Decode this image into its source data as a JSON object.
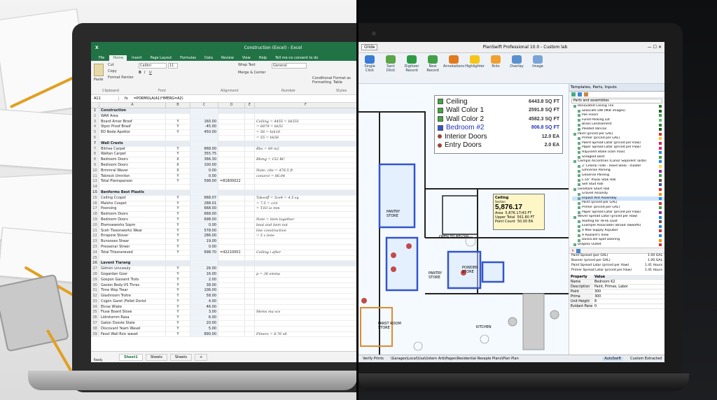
{
  "excel": {
    "title": "Construction (Excel) - Excel",
    "search": "Tell me no consent to do",
    "tabs": [
      "File",
      "Home",
      "Insert",
      "Page Layout",
      "Formulas",
      "Data",
      "Review",
      "View",
      "Help",
      "Help"
    ],
    "ribbon": {
      "paste": "Paste",
      "cut": "Cut",
      "copy": "Copy",
      "format_painter": "Format Painter",
      "clipboard": "Clipboard",
      "font_name": "Calibri",
      "font_size": "11",
      "font": "Font",
      "wrap": "Wrap Text",
      "merge": "Merge & Center",
      "alignment": "Alignment",
      "number_format": "General",
      "number": "Number",
      "cond": "Conditional Formatting",
      "format_as": "Format as Table",
      "styles": "Styles"
    },
    "name_box": "A11",
    "formula": "=PORMULA(A1)*IMERG=A2)",
    "columns": [
      "A",
      "B",
      "C",
      "D",
      "E",
      "F"
    ],
    "rows": [
      {
        "n": "1",
        "a": "Construction",
        "b": "",
        "c": "",
        "d": "",
        "f": "",
        "sec": true
      },
      {
        "n": "2",
        "a": "WAR Area",
        "b": "",
        "c": "",
        "d": "",
        "f": ""
      },
      {
        "n": "3",
        "a": "Board Arner Broof",
        "b": "Y",
        "c": "160.00",
        "d": "",
        "f": "Ceiling = 4455 = bk551"
      },
      {
        "n": "4",
        "a": "Stpor Proof Braof",
        "b": "Y",
        "c": "-45.00",
        "d": "",
        "f": "= 6879 = bk51"
      },
      {
        "n": "5",
        "a": "ED Node Apottor",
        "b": "Y",
        "c": "450.00",
        "d": "",
        "f": "= 56 = b(k16"
      },
      {
        "n": "6",
        "a": "",
        "b": "",
        "c": "",
        "d": "",
        "f": "= 55 = bk56"
      },
      {
        "n": "7",
        "a": "Wall Crests",
        "b": "",
        "c": "",
        "d": "",
        "f": "",
        "sec": true
      },
      {
        "n": "7",
        "a": "Bikhse Carpet",
        "b": "Y",
        "c": "668.00",
        "d": "",
        "f": "Rbs = 89 m2"
      },
      {
        "n": "8",
        "a": "Waltan Carpet",
        "b": "Y",
        "c": "355.75",
        "d": "",
        "f": ""
      },
      {
        "n": "8",
        "a": "Bedroom Doors",
        "b": "X",
        "c": "366.30",
        "d": "",
        "f": "Rbmg = 152 BC"
      },
      {
        "n": "9",
        "a": "Bedroom Doors",
        "b": "X",
        "c": "100.00",
        "d": "",
        "f": ""
      },
      {
        "n": "10",
        "a": "Brmmral Waver",
        "b": "X",
        "c": "0.00",
        "d": "",
        "f": "Note: cite = 476.5 ft"
      },
      {
        "n": "11",
        "a": "Tobrock Umnlion",
        "b": "Y",
        "c": "0.00",
        "d": "",
        "f": "conorct = 86.04"
      },
      {
        "n": "13",
        "a": "Total Plamsparson",
        "b": "Y",
        "c": "598.00",
        "d": "=81800022",
        "f": ""
      },
      {
        "n": "14",
        "a": "",
        "b": "",
        "c": "",
        "d": "",
        "f": ""
      },
      {
        "n": "15",
        "a": "Benforms Best Plastls",
        "b": "",
        "c": "",
        "d": "",
        "f": "",
        "sec": true
      },
      {
        "n": "15",
        "a": "Ceiling Ccopst",
        "b": "Y",
        "c": "668.07",
        "d": "",
        "f": "Takeoff = 5ce4 = 4.5 sq"
      },
      {
        "n": "16",
        "a": "Malsho Cospet",
        "b": "Y",
        "c": "288.01",
        "d": "",
        "f": "= 7.5 = c/ct"
      },
      {
        "n": "17",
        "a": "Poonsing",
        "b": "Y",
        "c": "668.00",
        "d": "",
        "f": "= T.03 ie mm"
      },
      {
        "n": "18",
        "a": "Bedroom Doors",
        "b": "Y",
        "c": "668.00",
        "d": "",
        "f": ""
      },
      {
        "n": "19",
        "a": "Bedroom Doors",
        "b": "Y",
        "c": "698.00",
        "d": "",
        "f": "Note = item together"
      },
      {
        "n": "20",
        "a": "Etemseworks Sopm",
        "b": "Y",
        "c": "0.00",
        "d": "",
        "f": "beat and item not"
      },
      {
        "n": "21",
        "a": "Sceh Tiseonworks Wear",
        "b": "Y",
        "c": "578.00",
        "d": "",
        "f": "line construction"
      },
      {
        "n": "22",
        "a": "Errapore Stover",
        "b": "Y",
        "c": "286.00",
        "d": "",
        "f": "= 5 x lene"
      },
      {
        "n": "23",
        "a": "Bunooses Shear",
        "b": "Y",
        "c": "19.00",
        "d": "",
        "f": ""
      },
      {
        "n": "23",
        "a": "Pressenar Streer",
        "b": "Y",
        "c": "0.00",
        "d": "",
        "f": ""
      },
      {
        "n": "24",
        "a": "Total Titesnereved",
        "b": "Y",
        "c": "698.70",
        "d": "=42210001",
        "f": "Ceiling i after"
      },
      {
        "n": "25",
        "a": "",
        "b": "",
        "c": "",
        "d": "",
        "f": ""
      },
      {
        "n": "26",
        "a": "Lavent Tiarang",
        "b": "",
        "c": "",
        "d": "",
        "f": "",
        "sec": true
      },
      {
        "n": "27",
        "a": "Gidrsin Lincsouly",
        "b": "Y",
        "c": "26.00",
        "d": "",
        "f": ""
      },
      {
        "n": "28",
        "a": "Gogardan Goor",
        "b": "Y",
        "c": "16.00",
        "d": "",
        "f": "p = 36 emma"
      },
      {
        "n": "29",
        "a": "Gospon Gassent Trots",
        "b": "Y",
        "c": "2.00",
        "d": "",
        "f": ""
      },
      {
        "n": "30",
        "a": "Gasion Body-VS Thras",
        "b": "Y",
        "c": "38.00",
        "d": "",
        "f": ""
      },
      {
        "n": "31",
        "a": "Time Wsp Trear",
        "b": "Y",
        "c": "106.00",
        "d": "",
        "f": ""
      },
      {
        "n": "32",
        "a": "Glashroom Trotre",
        "b": "Y",
        "c": "58.00",
        "d": "",
        "f": ""
      },
      {
        "n": "33",
        "a": "Cojpin Garet (Feliet Dorist",
        "b": "Y",
        "c": "4.00",
        "d": "",
        "f": ""
      },
      {
        "n": "34",
        "a": "Etnse Wlate",
        "b": "Y",
        "c": "46.00",
        "d": "",
        "f": ""
      },
      {
        "n": "35",
        "a": "Fiuse Board Stose",
        "b": "Y",
        "c": "3.00",
        "d": "",
        "f": "Mems ma scs"
      },
      {
        "n": "36",
        "a": "Lidrstomm Rasa",
        "b": "Y",
        "c": "6.00",
        "d": "",
        "f": ""
      },
      {
        "n": "37",
        "a": "Gaton Dosste State",
        "b": "Y",
        "c": "20.00",
        "d": "",
        "f": ""
      },
      {
        "n": "38",
        "a": "Discovant Yeam Wavel",
        "b": "Y",
        "c": "5.00",
        "d": "",
        "f": ""
      },
      {
        "n": "39",
        "a": "Fasst Wall Rsic waset",
        "b": "Y",
        "c": "890.00",
        "d": "",
        "f": "Flmers = 8.76 s8"
      }
    ],
    "sheets": [
      "Sheet1",
      "Sheets",
      "Sheets"
    ],
    "status": "Ready"
  },
  "planswift": {
    "title": "PlanSwift Professional 10.0 - Custom lab",
    "file_tab": "Glide",
    "ribbon": [
      {
        "label": "Single Click",
        "color": "#3a7bd5"
      },
      {
        "label": "Sent Dlick",
        "color": "#5ba44a"
      },
      {
        "label": "Digitizer Record",
        "color": "#2f9a45"
      },
      {
        "label": "New Record",
        "color": "#43a047"
      },
      {
        "label": "Annotations",
        "color": "#e07a1f"
      },
      {
        "label": "Highlighter",
        "color": "#f5c518"
      },
      {
        "label": "Rnts",
        "color": "#f0a030"
      },
      {
        "label": "Overlay",
        "color": "#5a8fd0"
      },
      {
        "label": "Image",
        "color": "#7aa4d6"
      }
    ],
    "groups": {
      "record": "Record",
      "annotations": "Annotations"
    },
    "legend": [
      {
        "name": "Ceiling",
        "qty": "6443.8 SQ FT",
        "color": "#3fa83f"
      },
      {
        "name": "Wall Color 1",
        "qty": "2591.8 SQ FT",
        "color": "#3fa83f"
      },
      {
        "name": "Wall Color 2",
        "qty": "4582.3 SQ FT",
        "color": "#3fa83f"
      },
      {
        "name": "Bedroom #2",
        "qty": "806.8 SQ FT",
        "color": "#3355cc",
        "blue": true
      },
      {
        "name": "Interior Doors",
        "qty": "12.0 EA",
        "color": "#cc3322",
        "dot": true
      },
      {
        "name": "Entry Doors",
        "qty": "2.0 EA",
        "color": "#cc3322",
        "dot": true
      }
    ],
    "callout": {
      "title": "Ceiling",
      "sub": "Section",
      "value": "5,876.17",
      "area_label": "Area",
      "area": "5,876.17/43 FT",
      "upper_label": "Upper Total",
      "upper": "561.80 FT",
      "count_label": "Point Count",
      "count": "50.00 EA"
    },
    "rooms": [
      "OPEN TO BELOW",
      "PANTRY STORE",
      "POWDER STORE",
      "KITCHEN",
      "FARST ROOM STORE",
      "PANTRY STORE"
    ],
    "panel_title": "Templates, Parts, Inputs",
    "panel_dropdown": "Parts and assemblies",
    "tree": [
      {
        "t": "Renovated Ceiling Tile",
        "c": "#2e7d32"
      },
      {
        "t": "Seascafe DW (Mat images)",
        "c": "#1b5e20"
      },
      {
        "t": "Pile Floors",
        "c": "#43a047"
      },
      {
        "t": "Fured Parking Lot",
        "c": "#66bb6a"
      },
      {
        "t": "Brass Londsoment",
        "c": "#2e7d32"
      },
      {
        "t": "Pleated Varicos",
        "c": "#1b5e20"
      },
      {
        "t": "Paint (priced per GAL)",
        "c": "#d32f2f"
      },
      {
        "t": "Primer (priced per GAL)",
        "c": "#fbc02d"
      },
      {
        "t": "Paerd Spread Latar (priced per Haw)",
        "c": "#d81b60"
      },
      {
        "t": "Paper Spread Latar (priced per Haw)",
        "c": "#e91e63"
      },
      {
        "t": "Hajussed Stoke (sam max)",
        "c": "#1e88e5"
      },
      {
        "t": "Sreaglod Dest",
        "c": "#43a047"
      },
      {
        "t": "Ceimpls Accentries (Conor Seporent Taste)",
        "c": "#1e88e5"
      },
      {
        "t": "2' Celeral Tilde - Hoed Stelo - Inalder",
        "c": "#fdd835"
      },
      {
        "t": "Gmnerise Pareing",
        "c": "#8e24aa"
      },
      {
        "t": "Geoerise Pareing",
        "c": "#43a047"
      },
      {
        "t": "L-16\" Plussi Stak Hall",
        "c": "#6d4c41"
      },
      {
        "t": "Sell Stud Hall",
        "c": "#3949ab"
      },
      {
        "t": "Genetare Short Hall",
        "c": "#d32f2f"
      },
      {
        "t": "Gravell Assondy",
        "c": "#fb8c00"
      },
      {
        "t": "Impact Pint Assembly",
        "c": "#1e88e5",
        "sel": true
      },
      {
        "t": "Paint (priced per GAL)",
        "c": "#d32f2f"
      },
      {
        "t": "Primer (priced per GAL)",
        "c": "#43a047"
      },
      {
        "t": "Paper Spread Latar (priced per Haw)",
        "c": "#8e24aa"
      },
      {
        "t": "Wever Spread Latar (priced per Haw)",
        "c": "#1e88e5"
      },
      {
        "t": "Roofing for HFVE Dust",
        "c": "#6d4c41"
      },
      {
        "t": "Example Associates (Broad Takeoffs)",
        "c": "#1e88e5"
      },
      {
        "t": "4 Max Supply Rcpubor",
        "c": "#d32f2f"
      },
      {
        "t": "A Ruolant's View",
        "c": "#1e88e5"
      },
      {
        "t": "Dusco.ale Spot Dooring",
        "c": "#fb8c00"
      },
      {
        "t": "Draplex Outlet",
        "c": "#d32f2f"
      }
    ],
    "items": [
      {
        "t": "Paint Spread (per GAL)",
        "q": "1.00 GAL"
      },
      {
        "t": "Baxner (priced per GAL)",
        "q": "1.00 GAL"
      },
      {
        "t": "Paint Spread Latar (priced per Haw)",
        "q": "1.41 Hours"
      },
      {
        "t": "Primer Spread Latar (priced per Haw)",
        "q": "1.41 Hours"
      }
    ],
    "props_header": {
      "k": "Property",
      "v": "Value"
    },
    "props": [
      {
        "k": "Name",
        "v": "Bedroom K2"
      },
      {
        "k": "Description",
        "v": "Paint, Primes, Labor"
      },
      {
        "k": "Point Converng",
        "v": "300"
      },
      {
        "k": "Prima Carumee",
        "v": "300"
      },
      {
        "k": "Unit Height",
        "v": "8"
      },
      {
        "k": "Evidant Pane",
        "v": "0"
      }
    ],
    "status_left": "Verify Prints",
    "status_path": "\\Garages\\Local\\Usa\\Ustern Arb\\Pages\\Residential Reseple Plans\\Plan Plan",
    "status_btn1": "AutoSwift",
    "status_btn2": "Custom Extracted"
  }
}
